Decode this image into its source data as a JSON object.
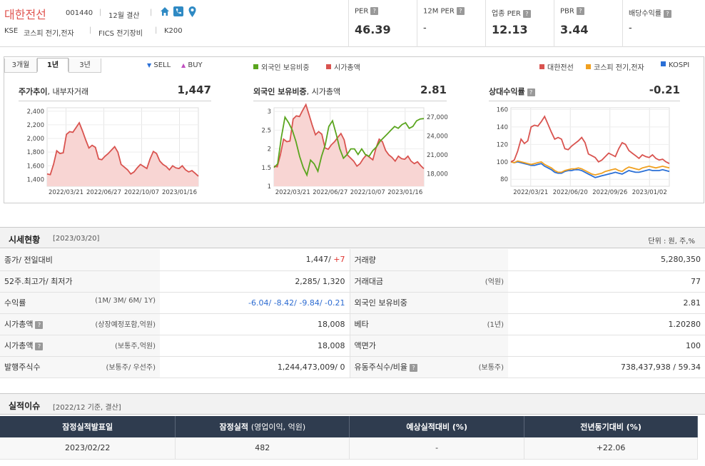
{
  "header": {
    "company_name": "대한전선",
    "code": "001440",
    "settlement": "12월 결산",
    "market": "KSE",
    "kospi_sector": "코스피 전기,전자",
    "fics_sector": "FICS 전기장비",
    "index": "K200",
    "icons": [
      "home-icon",
      "phone-icon",
      "location-icon"
    ],
    "metrics": [
      {
        "label": "PER",
        "value": "46.39"
      },
      {
        "label": "12M PER",
        "value": "-"
      },
      {
        "label": "업종 PER",
        "value": "12.13"
      },
      {
        "label": "PBR",
        "value": "3.44"
      },
      {
        "label": "배당수익률",
        "value": "-"
      }
    ]
  },
  "chart_panel": {
    "tabs": [
      "3개월",
      "1년",
      "3년"
    ],
    "active_tab": "1년",
    "legend_sell": "SELL",
    "legend_buy": "BUY",
    "legend_foreign": "외국인 보유비중",
    "legend_mcap": "시가총액",
    "legend_company": "대한전선",
    "legend_sector": "코스피 전기,전자",
    "legend_kospi": "KOSPI",
    "colors": {
      "red": "#d9534f",
      "green": "#5aa51e",
      "orange": "#f0a020",
      "blue": "#2a6fd6",
      "sell": "#2a6fd6",
      "buy": "#c050c0"
    }
  },
  "chart_data": [
    {
      "type": "area",
      "title": "주가추이",
      "subtitle": "내부자거래",
      "value_label": "1,447",
      "ylim": [
        1300,
        2450
      ],
      "yticks": [
        "2,400",
        "2,200",
        "2,000",
        "1,800",
        "1,600",
        "1,400"
      ],
      "ytick_values": [
        2400,
        2200,
        2000,
        1800,
        1600,
        1400
      ],
      "xticks": [
        "2022/03/21",
        "2022/06/27",
        "2022/10/07",
        "2023/01/16"
      ],
      "series": [
        {
          "values": [
            1480,
            1470,
            1620,
            1820,
            1780,
            1790,
            2060,
            2100,
            2090,
            2160,
            2230,
            2110,
            1980,
            1860,
            1900,
            1870,
            1700,
            1690,
            1740,
            1780,
            1830,
            1880,
            1800,
            1620,
            1580,
            1540,
            1480,
            1510,
            1570,
            1620,
            1590,
            1560,
            1700,
            1810,
            1780,
            1670,
            1620,
            1590,
            1540,
            1600,
            1570,
            1560,
            1600,
            1540,
            1510,
            1530,
            1490,
            1447
          ]
        }
      ]
    },
    {
      "type": "line",
      "title": "외국인 보유비중",
      "subtitle": "시가총액",
      "value_label": "2.81",
      "ylim": [
        1,
        3.1
      ],
      "yticks": [
        "3",
        "2.5",
        "2",
        "1.5",
        "1"
      ],
      "ytick_values": [
        3,
        2.5,
        2,
        1.5,
        1
      ],
      "y2lim": [
        16000,
        28500
      ],
      "y2ticks": [
        "27,000",
        "24,000",
        "21,000",
        "18,000"
      ],
      "y2tick_values": [
        27000,
        24000,
        21000,
        18000
      ],
      "xticks": [
        "2022/03/21",
        "2022/06/27",
        "2022/10/07",
        "2023/01/16"
      ],
      "series": [
        {
          "name": "외국인 보유비중",
          "values": [
            1.5,
            1.6,
            2.3,
            2.85,
            2.7,
            2.5,
            2.2,
            1.8,
            1.5,
            1.3,
            1.7,
            1.6,
            1.4,
            1.8,
            2.1,
            2.6,
            2.75,
            2.4,
            2.0,
            1.75,
            1.85,
            2.0,
            2.0,
            1.85,
            2.0,
            1.85,
            1.8,
            1.95,
            2.05,
            2.2,
            2.3,
            2.4,
            2.5,
            2.6,
            2.55,
            2.65,
            2.7,
            2.55,
            2.6,
            2.75,
            2.8,
            2.81
          ]
        },
        {
          "name": "시가총액",
          "values": [
            19200,
            19100,
            21000,
            23500,
            23100,
            23200,
            26700,
            27200,
            27100,
            28100,
            29000,
            27400,
            25700,
            24200,
            24700,
            24300,
            22100,
            21900,
            22600,
            23100,
            23800,
            24400,
            23400,
            21000,
            20500,
            20000,
            19200,
            19600,
            20400,
            21000,
            20600,
            20200,
            22100,
            23500,
            23100,
            21700,
            21000,
            20600,
            20000,
            20800,
            20400,
            20300,
            20800,
            20000,
            19600,
            19900,
            19300,
            18800
          ]
        }
      ]
    },
    {
      "type": "line",
      "title": "상대수익률",
      "value_label": "-0.21",
      "ylim": [
        72,
        162
      ],
      "yticks": [
        "160",
        "140",
        "120",
        "100",
        "80"
      ],
      "ytick_values": [
        160,
        140,
        120,
        100,
        80
      ],
      "xticks": [
        "2022/03/21",
        "2022/06/20",
        "2022/09/26",
        "2023/01/02"
      ],
      "series": [
        {
          "name": "대한전선",
          "values": [
            100,
            102,
            112,
            126,
            121,
            124,
            140,
            142,
            141,
            146,
            152,
            143,
            134,
            126,
            128,
            126,
            115,
            114,
            118,
            121,
            124,
            128,
            122,
            109,
            107,
            105,
            100,
            102,
            106,
            110,
            108,
            106,
            115,
            122,
            120,
            113,
            110,
            107,
            104,
            108,
            106,
            105,
            108,
            104,
            102,
            103,
            100,
            98
          ]
        },
        {
          "name": "코스피 전기,전자",
          "values": [
            100,
            99,
            101,
            100,
            99,
            98,
            97,
            98,
            99,
            100,
            97,
            95,
            93,
            90,
            88,
            88,
            90,
            91,
            92,
            92,
            93,
            92,
            90,
            88,
            86,
            85,
            86,
            87,
            89,
            90,
            91,
            92,
            90,
            89,
            92,
            94,
            93,
            92,
            91,
            93,
            94,
            95,
            94,
            93,
            94,
            95,
            94,
            93
          ]
        },
        {
          "name": "KOSPI",
          "values": [
            100,
            99,
            100,
            99,
            98,
            97,
            96,
            96,
            97,
            98,
            95,
            93,
            91,
            88,
            87,
            87,
            89,
            90,
            90,
            91,
            91,
            90,
            88,
            86,
            84,
            82,
            83,
            84,
            85,
            86,
            87,
            88,
            87,
            86,
            88,
            90,
            89,
            88,
            88,
            89,
            90,
            91,
            90,
            90,
            90,
            91,
            90,
            89
          ]
        }
      ]
    }
  ],
  "sise": {
    "title": "시세현황",
    "date": "[2023/03/20]",
    "unit": "단위 : 원, 주,%",
    "rows": [
      {
        "l1": "종가/ 전일대비",
        "s1": "",
        "v1a": "1,447/ ",
        "v1b": "+7",
        "l2": "거래량",
        "s2": "",
        "v2": "5,280,350"
      },
      {
        "l1": "52주.최고가/ 최저가",
        "s1": "",
        "v1a": "2,285/ 1,320",
        "v1b": "",
        "l2": "거래대금",
        "s2": "(억원)",
        "v2": "77"
      },
      {
        "l1": "수익률",
        "s1": "(1M/ 3M/ 6M/ 1Y)",
        "v1a": "",
        "v1b": "-6.04/ -8.42/ -9.84/ -0.21",
        "l2": "외국인 보유비중",
        "s2": "",
        "v2": "2.81"
      },
      {
        "l1": "시가총액",
        "s1": "(상장예정포함,억원)",
        "v1a": "18,008",
        "v1b": "",
        "l2": "베타",
        "s2": "(1년)",
        "v2": "1.20280"
      },
      {
        "l1": "시가총액",
        "s1": "(보통주,억원)",
        "v1a": "18,008",
        "v1b": "",
        "l2": "액면가",
        "s2": "",
        "v2": "100"
      },
      {
        "l1": "발행주식수",
        "s1": "(보통주/ 우선주)",
        "v1a": "1,244,473,009/ 0",
        "v1b": "",
        "l2": "유동주식수/비율",
        "s2": "(보통주)",
        "v2": "738,437,938 / 59.34"
      }
    ]
  },
  "perf": {
    "title": "실적이슈",
    "date": "[2022/12 기준, 결산]",
    "headers": [
      "잠정실적발표일",
      "잠정실적",
      "(영업이익, 억원)",
      "예상실적대비 (%)",
      "전년동기대비 (%)"
    ],
    "row": [
      "2023/02/22",
      "482",
      "-",
      "+22.06"
    ]
  }
}
